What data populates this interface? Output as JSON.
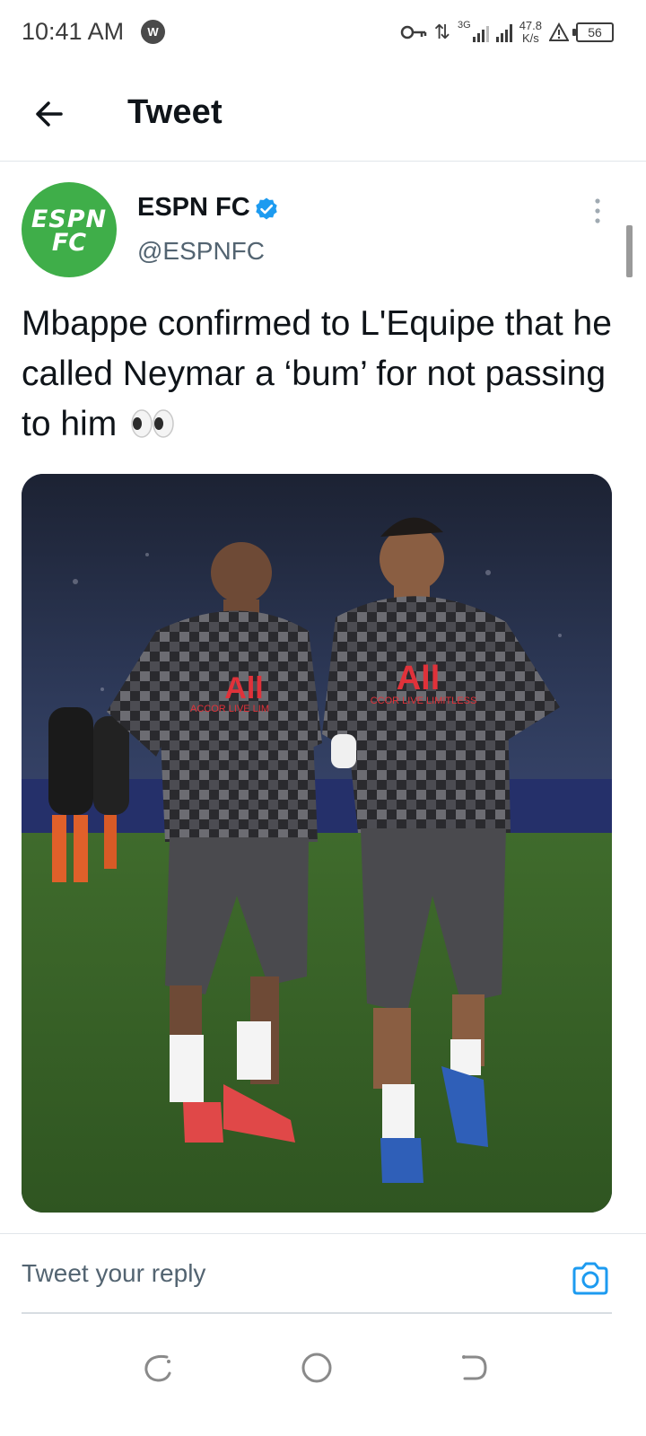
{
  "status_bar": {
    "time": "10:41 AM",
    "app_badge": "W",
    "network_type": "3G",
    "speed_value": "47.8",
    "speed_unit": "K/s",
    "battery": "56"
  },
  "header": {
    "title": "Tweet"
  },
  "tweet": {
    "author": {
      "name": "ESPN FC",
      "handle": "@ESPNFC",
      "avatar_logo_lines": [
        "ESPN",
        "FC"
      ],
      "verified": true
    },
    "text": "Mbappe confirmed to L'Equipe that he called Neymar a ‘bum’ for not passing to him",
    "emoji": "eyes",
    "media": {
      "type": "photo",
      "shirt_sponsor": "All",
      "shirt_tagline_left": "ACCOR LIVE LIM",
      "shirt_tagline_right": "CCOR LIVE LIMITLESS"
    }
  },
  "reply": {
    "placeholder": "Tweet your reply"
  },
  "colors": {
    "accent": "#1d9bf0",
    "avatar_bg": "#3fae49",
    "secondary_text": "#536471"
  },
  "icons": {
    "back": "arrow-left-icon",
    "verified": "verified-badge-icon",
    "more": "more-vertical-icon",
    "camera": "camera-icon",
    "nav_recents": "recents-icon",
    "nav_home": "home-circle-icon",
    "nav_back": "nav-back-icon"
  }
}
